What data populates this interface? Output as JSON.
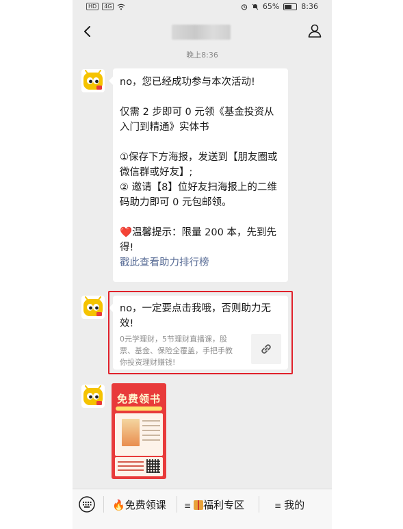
{
  "status_bar": {
    "left_badges": [
      "HD",
      "4G"
    ],
    "battery": "65%",
    "time": "8:36"
  },
  "nav": {
    "title": ""
  },
  "timestamp": "晚上8:36",
  "message1": {
    "line1": "no，您已经成功参与本次活动!",
    "line2": "仅需 2 步即可 0 元领《基金投资从入门到精通》实体书",
    "line3": "①保存下方海报，发送到【朋友圈或微信群或好友】;",
    "line4": "② 邀请【8】位好友扫海报上的二维码助力即可 0 元包邮领。",
    "line5_heart": "❤️",
    "line5": "温馨提示：限量 200 本，先到先得!",
    "link": "戳此查看助力排行榜"
  },
  "message2": {
    "title": "no，一定要点击我哦，否则助力无效!",
    "description": "0元学理财，5节理财直播课，股票、基金、保险全覆盖，手把手教你投资理财赚钱!"
  },
  "poster": {
    "title": "免费领书"
  },
  "bottom_menu": {
    "item1": "免费领课",
    "item2": "福利专区",
    "item3": "我的"
  },
  "colors": {
    "highlight_border": "#e0202a",
    "link": "#576b95",
    "chat_bg": "#ededed",
    "avatar_yellow": "#f5c300"
  }
}
